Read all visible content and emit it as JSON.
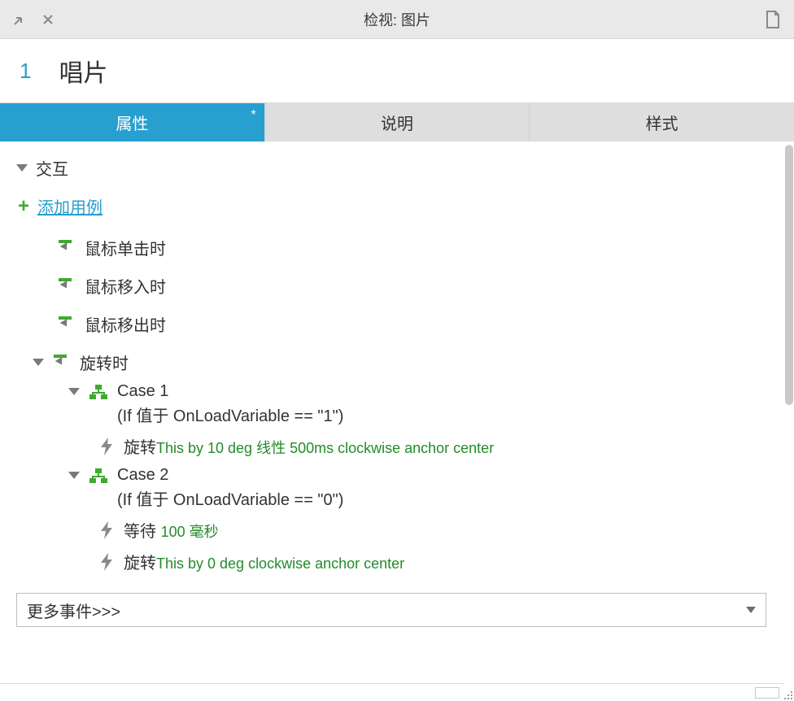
{
  "titlebar": {
    "title": "检视: 图片"
  },
  "header": {
    "index": "1",
    "name": "唱片"
  },
  "tabs": [
    {
      "label": "属性",
      "active": true,
      "dirty": "*"
    },
    {
      "label": "说明",
      "active": false
    },
    {
      "label": "样式",
      "active": false
    }
  ],
  "section": {
    "interactions_label": "交互",
    "add_case_label": "添加用例"
  },
  "events": {
    "click": "鼠标单击时",
    "mouseenter": "鼠标移入时",
    "mouseleave": "鼠标移出时",
    "rotate": "旋转时"
  },
  "cases": [
    {
      "title": "Case 1",
      "condition": "(If 值于 OnLoadVariable == \"1\")",
      "actions": [
        {
          "cmd": "旋转",
          "param": "This by 10 deg 线性 500ms clockwise anchor center"
        }
      ]
    },
    {
      "title": "Case 2",
      "condition": "(If 值于 OnLoadVariable == \"0\")",
      "actions": [
        {
          "cmd": "等待 ",
          "param": "100 毫秒"
        },
        {
          "cmd": "旋转",
          "param": "This by 0 deg clockwise anchor center"
        }
      ]
    }
  ],
  "more_events": {
    "label": "更多事件>>>"
  }
}
